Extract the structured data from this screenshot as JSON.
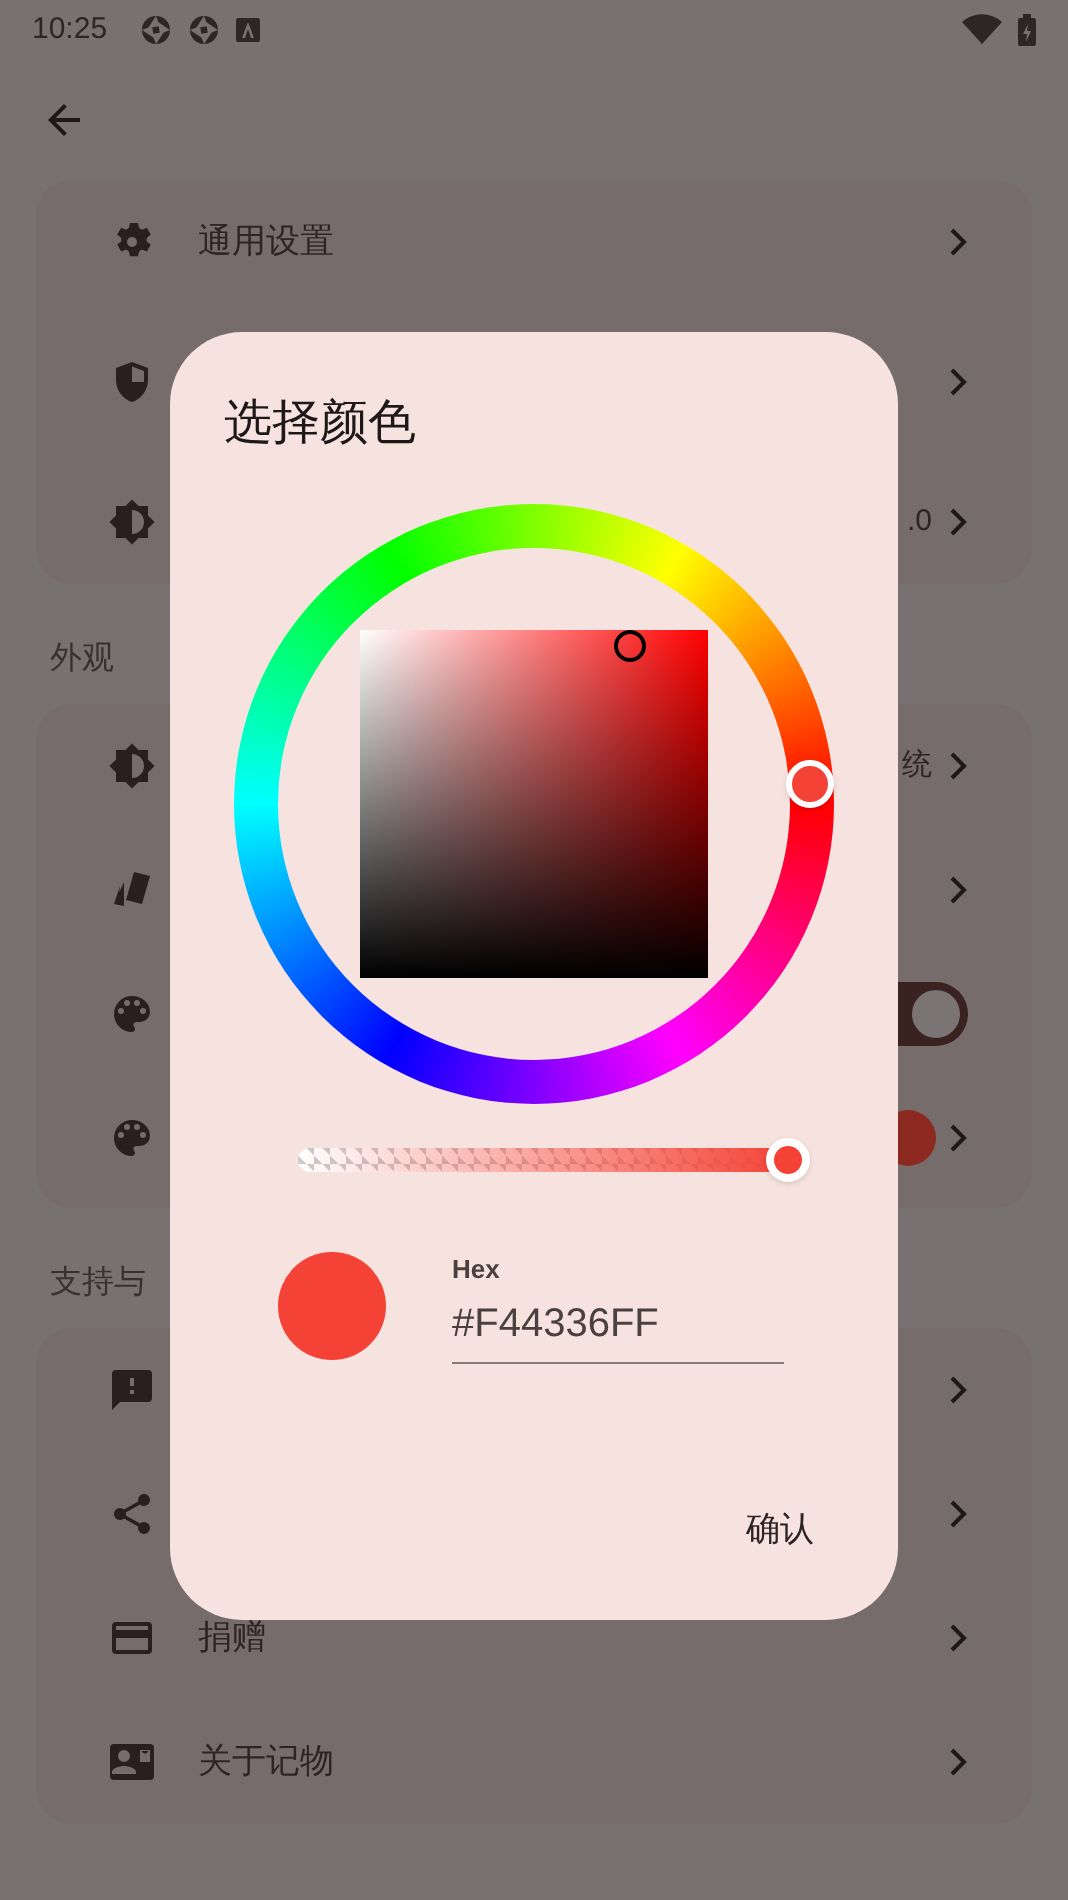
{
  "status_bar": {
    "time": "10:25"
  },
  "sections": [
    {
      "rows": [
        {
          "title": "通用设置",
          "kind": "chevron"
        },
        {
          "kind": "chevron",
          "tall": true
        },
        {
          "kind": "chevron",
          "value": ".0"
        }
      ]
    },
    {
      "label": "外观",
      "rows": [
        {
          "kind": "chevron",
          "value": "统"
        },
        {
          "kind": "chevron"
        },
        {
          "kind": "switch",
          "on": true
        },
        {
          "kind": "color",
          "color": "#8c2a22"
        }
      ]
    },
    {
      "label": "支持与",
      "rows": [
        {
          "kind": "chevron"
        },
        {
          "kind": "chevron"
        },
        {
          "title": "捐赠",
          "kind": "chevron"
        },
        {
          "title": "关于记物",
          "kind": "chevron"
        }
      ]
    }
  ],
  "dialog": {
    "title": "选择颜色",
    "color": "#f44336",
    "alpha": {
      "level": 1
    },
    "hex": {
      "label": "Hex",
      "value": "#F44336FF"
    },
    "confirm": "确认"
  }
}
